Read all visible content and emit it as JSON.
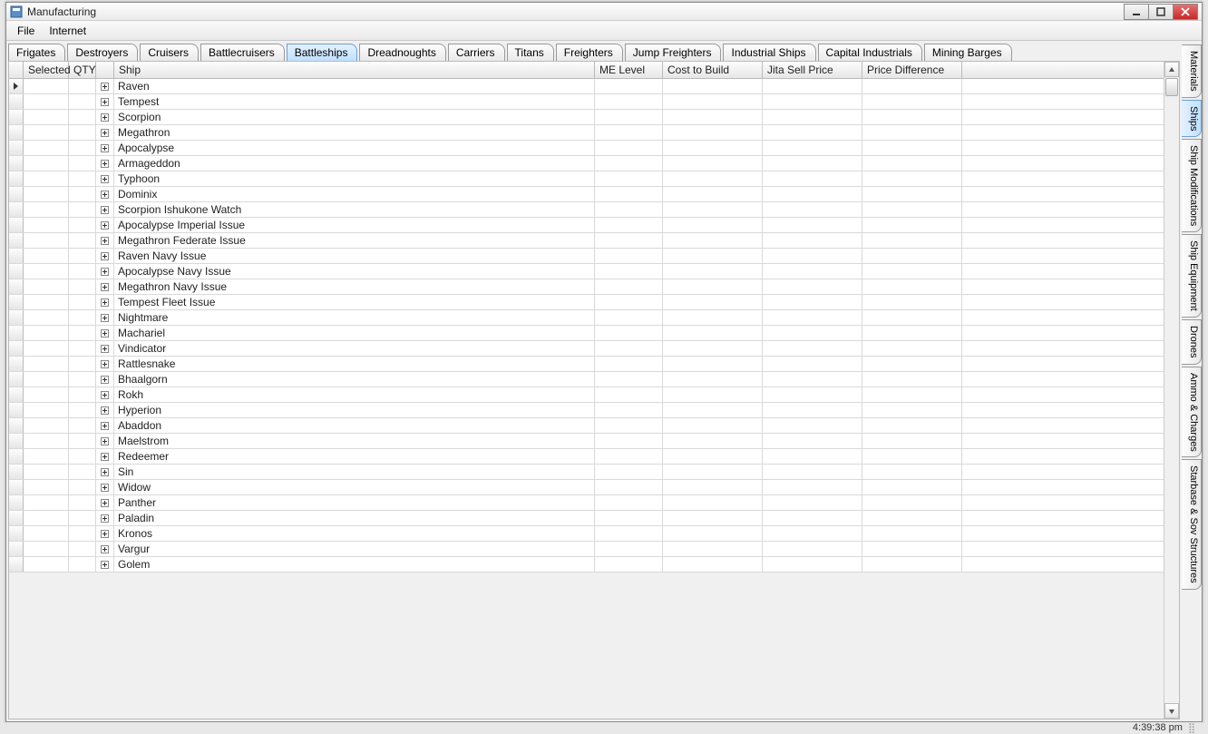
{
  "window": {
    "title": "Manufacturing"
  },
  "menu": {
    "items": [
      "File",
      "Internet"
    ]
  },
  "topTabs": [
    {
      "label": "Frigates",
      "active": false
    },
    {
      "label": "Destroyers",
      "active": false
    },
    {
      "label": "Cruisers",
      "active": false
    },
    {
      "label": "Battlecruisers",
      "active": false
    },
    {
      "label": "Battleships",
      "active": true
    },
    {
      "label": "Dreadnoughts",
      "active": false
    },
    {
      "label": "Carriers",
      "active": false
    },
    {
      "label": "Titans",
      "active": false
    },
    {
      "label": "Freighters",
      "active": false
    },
    {
      "label": "Jump Freighters",
      "active": false
    },
    {
      "label": "Industrial Ships",
      "active": false
    },
    {
      "label": "Capital Industrials",
      "active": false
    },
    {
      "label": "Mining Barges",
      "active": false
    }
  ],
  "sideTabs": [
    {
      "label": "Materials",
      "active": false
    },
    {
      "label": "Ships",
      "active": true
    },
    {
      "label": "Ship Modifications",
      "active": false
    },
    {
      "label": "Ship Equipment",
      "active": false
    },
    {
      "label": "Drones",
      "active": false
    },
    {
      "label": "Ammo & Charges",
      "active": false
    },
    {
      "label": "Starbase & Sov Structures",
      "active": false
    }
  ],
  "grid": {
    "columns": {
      "selected": "Selected",
      "qty": "QTY",
      "ship": "Ship",
      "meLevel": "ME Level",
      "costToBuild": "Cost to Build",
      "jitaSellPrice": "Jita Sell Price",
      "priceDifference": "Price Difference"
    },
    "rows": [
      {
        "ship": "Raven",
        "current": true
      },
      {
        "ship": "Tempest"
      },
      {
        "ship": "Scorpion"
      },
      {
        "ship": "Megathron"
      },
      {
        "ship": "Apocalypse"
      },
      {
        "ship": "Armageddon"
      },
      {
        "ship": "Typhoon"
      },
      {
        "ship": "Dominix"
      },
      {
        "ship": "Scorpion Ishukone Watch"
      },
      {
        "ship": "Apocalypse Imperial Issue"
      },
      {
        "ship": "Megathron Federate Issue"
      },
      {
        "ship": "Raven Navy Issue"
      },
      {
        "ship": "Apocalypse Navy Issue"
      },
      {
        "ship": "Megathron Navy Issue"
      },
      {
        "ship": "Tempest Fleet Issue"
      },
      {
        "ship": "Nightmare"
      },
      {
        "ship": "Machariel"
      },
      {
        "ship": "Vindicator"
      },
      {
        "ship": "Rattlesnake"
      },
      {
        "ship": "Bhaalgorn"
      },
      {
        "ship": "Rokh"
      },
      {
        "ship": "Hyperion"
      },
      {
        "ship": "Abaddon"
      },
      {
        "ship": "Maelstrom"
      },
      {
        "ship": "Redeemer"
      },
      {
        "ship": "Sin"
      },
      {
        "ship": "Widow"
      },
      {
        "ship": "Panther"
      },
      {
        "ship": "Paladin"
      },
      {
        "ship": "Kronos"
      },
      {
        "ship": "Vargur"
      },
      {
        "ship": "Golem"
      }
    ]
  },
  "status": {
    "time": "4:39:38 pm"
  }
}
